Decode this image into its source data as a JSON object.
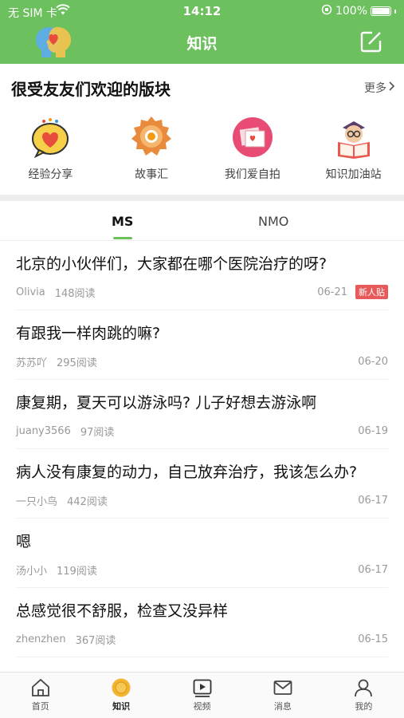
{
  "status_bar": {
    "carrier": "无 SIM 卡",
    "time": "14:12",
    "battery": "100%"
  },
  "header": {
    "title": "知识",
    "logo_icon": "heads-heart-logo-icon",
    "action_icon": "edit-icon"
  },
  "popular": {
    "title": "很受友友们欢迎的版块",
    "more": "更多",
    "categories": [
      {
        "label": "经验分享",
        "icon": "heart-speech-bubble-icon"
      },
      {
        "label": "故事汇",
        "icon": "sun-badge-icon"
      },
      {
        "label": "我们爱自拍",
        "icon": "photo-icon"
      },
      {
        "label": "知识加油站",
        "icon": "reading-book-icon"
      }
    ]
  },
  "tabs": [
    {
      "label": "MS",
      "active": true
    },
    {
      "label": "NMO",
      "active": false
    }
  ],
  "posts": [
    {
      "title": "北京的小伙伴们，大家都在哪个医院治疗的呀?",
      "author": "Olivia",
      "reads": "148阅读",
      "date": "06-21",
      "badge": "新人贴"
    },
    {
      "title": "有跟我一样肉跳的嘛?",
      "author": "苏苏吖",
      "reads": "295阅读",
      "date": "06-20",
      "badge": ""
    },
    {
      "title": "康复期，夏天可以游泳吗? 儿子好想去游泳啊",
      "author": "juany3566",
      "reads": "97阅读",
      "date": "06-19",
      "badge": ""
    },
    {
      "title": "病人没有康复的动力，自己放弃治疗，我该怎么办?",
      "author": "一只小鸟",
      "reads": "442阅读",
      "date": "06-17",
      "badge": ""
    },
    {
      "title": "嗯",
      "author": "汤小小",
      "reads": "119阅读",
      "date": "06-17",
      "badge": ""
    },
    {
      "title": "总感觉很不舒服，检查又没异样",
      "author": "zhenzhen",
      "reads": "367阅读",
      "date": "06-15",
      "badge": ""
    }
  ],
  "tabbar": [
    {
      "label": "首页",
      "icon": "home-icon",
      "active": false
    },
    {
      "label": "知识",
      "icon": "knowledge-circle-icon",
      "active": true
    },
    {
      "label": "视频",
      "icon": "video-icon",
      "active": false
    },
    {
      "label": "消息",
      "icon": "envelope-icon",
      "active": false
    },
    {
      "label": "我的",
      "icon": "user-icon",
      "active": false
    }
  ],
  "colors": {
    "brand_green": "#6cc05e",
    "badge_red": "#e85a5a",
    "active_tab_icon": "#f2b531"
  }
}
